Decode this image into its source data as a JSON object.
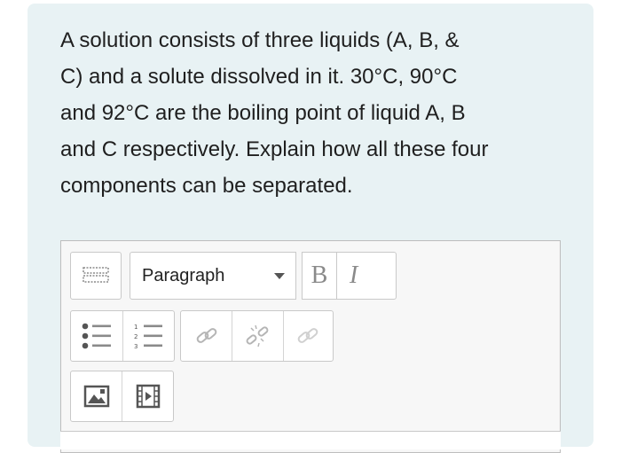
{
  "question": {
    "lines": [
      "A solution consists of three liquids (A, B, &",
      "C) and a solute dissolved in it. 30°C, 90°C",
      "and 92°C are the boiling point of liquid A, B",
      "and C respectively. Explain how all these four",
      "components can be separated."
    ]
  },
  "editor": {
    "paragraph_label": "Paragraph",
    "bold_label": "B",
    "italic_label": "I",
    "icons": {
      "toolbar_toggle": "show-more-buttons-icon",
      "dropdown": "chevron-down-icon",
      "bullet_list": "unordered-list-icon",
      "numbered_list": "ordered-list-icon",
      "link": "link-icon",
      "unlink": "unlink-icon",
      "link_disabled": "link-disabled-icon",
      "image": "image-icon",
      "media": "media-icon"
    }
  },
  "colors": {
    "card_background": "#e8f2f4",
    "text": "#1f1f1f",
    "toolbar_icon": "#8a8a8a",
    "editor_border": "#bdbdbd"
  }
}
